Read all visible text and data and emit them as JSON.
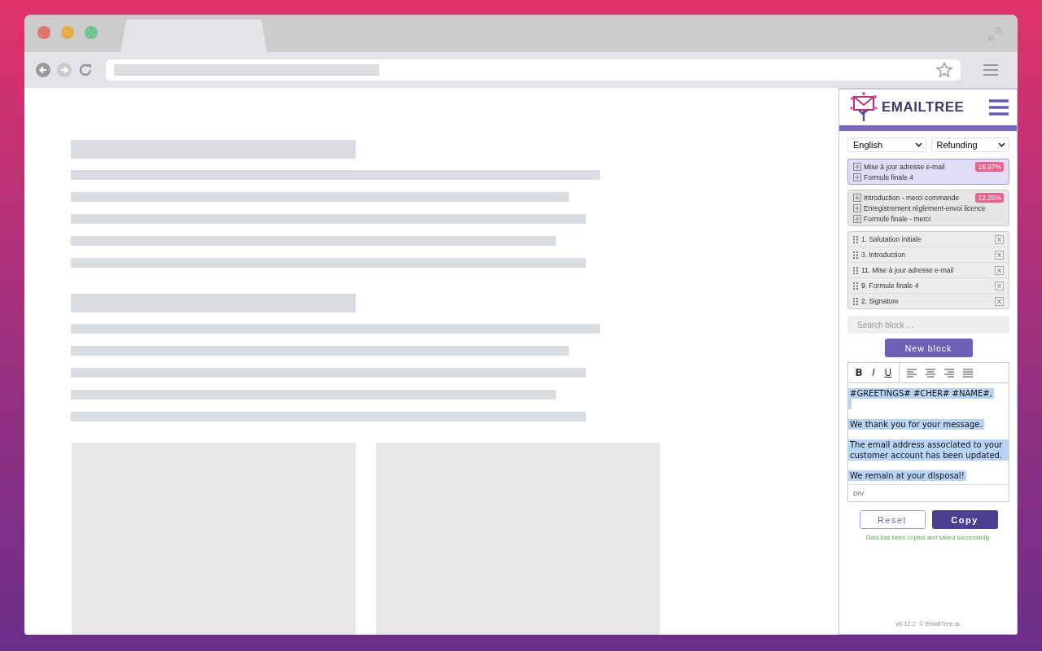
{
  "extension": {
    "logo_text": "EMAILTREE",
    "language": {
      "value": "English"
    },
    "category": {
      "value": "Refunding"
    },
    "suggestions": [
      {
        "selected": true,
        "percent": "16.97%",
        "items": [
          "Mise à jour adresse e-mail",
          "Formule finale 4"
        ]
      },
      {
        "selected": false,
        "percent": "12.25%",
        "items": [
          "Introduction - merci commande",
          "Enregistrement réglement-envoi licence",
          "Formule finale - merci"
        ]
      }
    ],
    "blocks": [
      {
        "label": "1. Salutation initiale",
        "remove": "X"
      },
      {
        "label": "3. Introduction",
        "remove": "X"
      },
      {
        "label": "11. Mise à jour adresse e-mail",
        "remove": "X"
      },
      {
        "label": "9. Formule finale 4",
        "remove": "X"
      },
      {
        "label": "2. Signature",
        "remove": "X"
      }
    ],
    "search": {
      "placeholder": "Search block ..."
    },
    "new_block_button": "New block",
    "editor": {
      "toolbar": [
        "B",
        "I",
        "U"
      ],
      "text_selected": true,
      "paragraphs": [
        [
          "#GREETINGS# #CHER# #NAME#,"
        ],
        [
          "We thank you for your message."
        ],
        [
          "The email address associated to your customer account has been updated."
        ],
        [
          "We remain at your disposal!"
        ]
      ],
      "status": "DIV"
    },
    "reset_button": "Reset",
    "copy_button": "Copy",
    "message": "Data has been copied and saved successfully.",
    "footer": "v0.12.2  © EmailTree.ai."
  }
}
